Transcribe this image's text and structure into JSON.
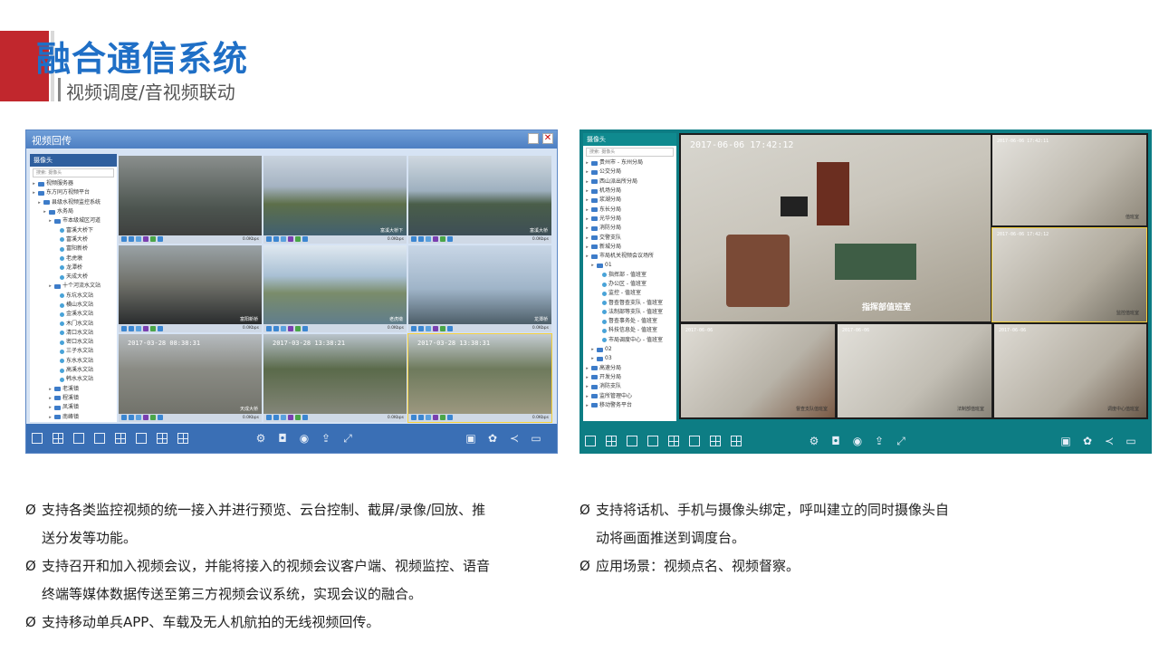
{
  "header": {
    "title": "融合通信系统",
    "subtitle": "视频调度/音视频联动"
  },
  "left_window": {
    "title": "视频回传",
    "tree_title": "摄像头",
    "search_placeholder": "搜索: 摄像头",
    "tree_items": [
      "视频服务器",
      "东方同方视频平台",
      "县级水视频监控系统",
      "水务局",
      "市本级城区河道",
      "富溪大桥下",
      "富溪大桥",
      "富阳新桥",
      "老虎墩",
      "龙潭桥",
      "天成大桥",
      "十个河流水文站",
      "东坑水文站",
      "横山水文站",
      "金溪水文站",
      "木门水文站",
      "清口水文站",
      "密口水文站",
      "三子水文站",
      "东水水文站",
      "高溪水文站",
      "韩水水文站",
      "老溪镇",
      "程溪镇",
      "凤溪镇",
      "南峰镇",
      "南山镇"
    ],
    "cells": [
      {
        "label": "",
        "rate": "0.0Kbps"
      },
      {
        "label": "富溪大桥下",
        "rate": "0.0Kbps"
      },
      {
        "label": "富溪大桥",
        "rate": "0.0Kbps"
      },
      {
        "label": "富阳新桥",
        "rate": "0.0Kbps"
      },
      {
        "label": "老虎墩",
        "rate": "0.0Kbps"
      },
      {
        "label": "龙潭桥",
        "rate": "0.0Kbps"
      },
      {
        "label": "天成大桥",
        "rate": "0.0Kbps"
      },
      {
        "label": "",
        "rate": "0.0Kbps"
      },
      {
        "label": "",
        "rate": "0.0Kbps"
      }
    ],
    "timestamps": [
      "2017-03-28",
      "2017-03-28 08:38:21",
      "2017-03-28 08:38:31",
      "2017-03-28 13:38:21",
      "2017-03-28 13:38:31"
    ]
  },
  "right_window": {
    "tree_title": "摄像头",
    "search_placeholder": "搜索: 摄像头",
    "tree_items": [
      "贵州市 - 东州分局",
      "公交分局",
      "西山派出所分局",
      "机场分局",
      "浆湖分局",
      "东长分局",
      "光华分局",
      "消防分局",
      "交警支队",
      "新城分局",
      "市局机关视频会议场所",
      "01",
      "指挥部 - 值班室",
      "办公区 - 值班室",
      "监控 - 值班室",
      "督查督查支队 - 值班室",
      "法制部等支队 - 值班室",
      "督查事务处 - 值班室",
      "科技信息处 - 值班室",
      "市局调度中心 - 值班室",
      "02",
      "03",
      "高速分局",
      "开发分局",
      "消防支队",
      "监所管理中心",
      "移动警务平台"
    ],
    "main_cell": {
      "timestamp": "2017-06-06 17:42:12",
      "label": "指挥部值班室"
    },
    "small_cells": [
      {
        "timestamp": "2017-06-06 17:42:11",
        "label": "值班室"
      },
      {
        "timestamp": "2017-06-06 17:42:12",
        "label": "监控值班室"
      },
      {
        "timestamp": "2017-06-06",
        "label": "督查支队值班室"
      },
      {
        "timestamp": "2017-06-06",
        "label": "法制部值班室"
      },
      {
        "timestamp": "2017-06-06",
        "label": "调度中心值班室"
      }
    ]
  },
  "left_bullets": [
    {
      "mark": "Ø",
      "lines": [
        "支持各类监控视频的统一接入并进行预览、云台控制、截屏/录像/回放、推",
        "送分发等功能。"
      ]
    },
    {
      "mark": "Ø",
      "lines": [
        "支持召开和加入视频会议，并能将接入的视频会议客户端、视频监控、语音",
        "终端等媒体数据传送至第三方视频会议系统，实现会议的融合。"
      ]
    },
    {
      "mark": "Ø",
      "lines": [
        "支持移动单兵APP、车载及无人机航拍的无线视频回传。"
      ]
    }
  ],
  "right_bullets": [
    {
      "mark": "Ø",
      "lines": [
        "支持将话机、手机与摄像头绑定，呼叫建立的同时摄像头自",
        "动将画面推送到调度台。"
      ]
    },
    {
      "mark": "Ø",
      "lines": [
        "应用场景：视频点名、视频督察。"
      ]
    }
  ],
  "colors": {
    "brand_red": "#c1272d",
    "title_blue": "#1f6fc6",
    "left_toolbar": "#3a6fb5",
    "right_toolbar": "#0d7d84"
  }
}
